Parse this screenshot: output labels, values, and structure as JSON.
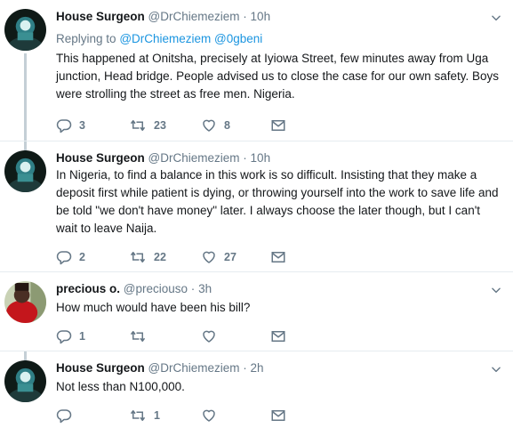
{
  "tweets": [
    {
      "name": "House Surgeon",
      "handle": "@DrChiemeziem",
      "dot": "·",
      "time": "10h",
      "replying_prefix": "Replying to",
      "replying_handles": "@DrChiemeziem @0gbeni",
      "text": "This happened at Onitsha, precisely at Iyiowa Street, few minutes away from Uga junction, Head bridge. People advised us to close the case for our own safety. Boys were strolling the street as free men. Nigeria.",
      "replies": "3",
      "retweets": "23",
      "likes": "8"
    },
    {
      "name": "House Surgeon",
      "handle": "@DrChiemeziem",
      "dot": "·",
      "time": "10h",
      "text": "In Nigeria, to find a balance in this work is so difficult. Insisting that they make a deposit first while patient is dying, or throwing yourself into the work to save life and be told \"we don't have money\" later. I always choose the later though, but I can't wait to leave Naija.",
      "replies": "2",
      "retweets": "22",
      "likes": "27"
    },
    {
      "name": "precious o.",
      "handle": "@preciouso",
      "dot": "·",
      "time": "3h",
      "text": "How much would have been his bill?",
      "replies": "1",
      "retweets": "",
      "likes": ""
    },
    {
      "name": "House Surgeon",
      "handle": "@DrChiemeziem",
      "dot": "·",
      "time": "2h",
      "text": "Not less than N100,000.",
      "replies": "",
      "retweets": "1",
      "likes": ""
    }
  ],
  "colors": {
    "accent": "#1b95e0",
    "muted": "#657786",
    "thread": "#c4cfd6",
    "text": "#14171a"
  }
}
